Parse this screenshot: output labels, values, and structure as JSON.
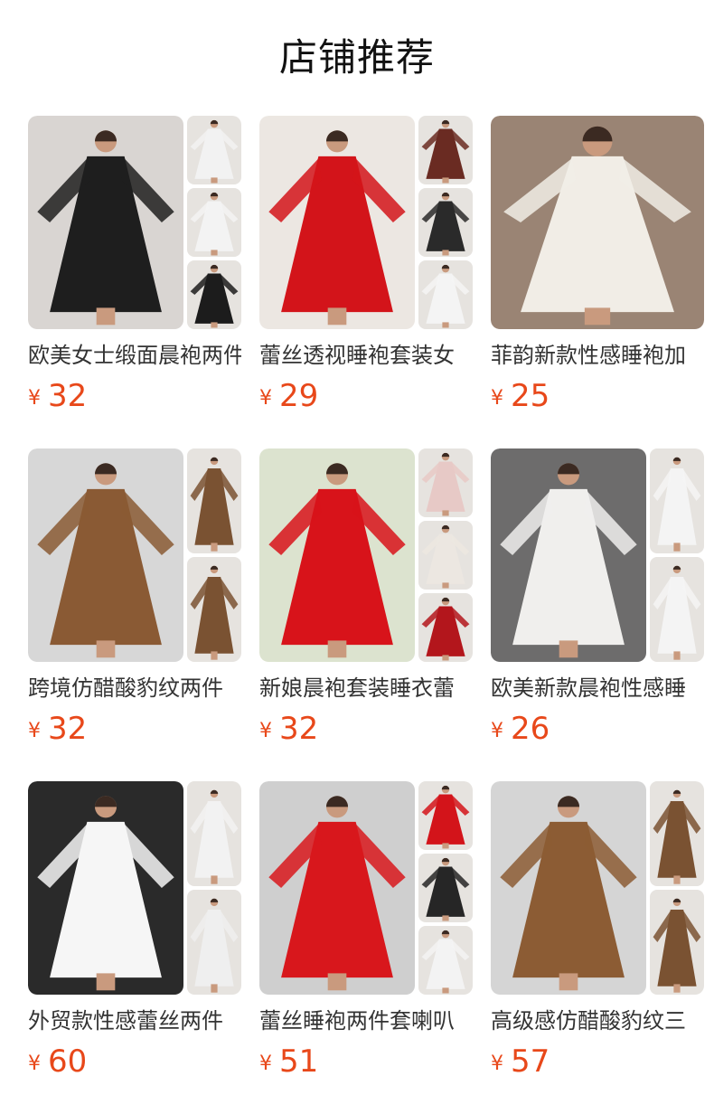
{
  "header": {
    "title": "店铺推荐"
  },
  "currency_symbol": "¥",
  "products": [
    {
      "name": "欧美女士缎面晨袍两件",
      "price": "32",
      "main_color": "#1e1e1e",
      "bg_color": "#d9d5d2",
      "thumbs": [
        "#f2f2f2",
        "#f3f3f3",
        "#1c1c1c"
      ]
    },
    {
      "name": "蕾丝透视睡袍套装女",
      "price": "29",
      "main_color": "#d3141a",
      "bg_color": "#ece7e2",
      "thumbs": [
        "#6a2b22",
        "#2a2a2a",
        "#f4f4f4"
      ]
    },
    {
      "name": "菲韵新款性感睡袍加",
      "price": "25",
      "main_color": "#f1ede6",
      "bg_color": "#9a8474",
      "thumbs": []
    },
    {
      "name": "跨境仿醋酸豹纹两件",
      "price": "32",
      "main_color": "#8a5a34",
      "bg_color": "#d7d7d7",
      "thumbs": [
        "#7a5232",
        "#7a5232"
      ]
    },
    {
      "name": "新娘晨袍套装睡衣蕾",
      "price": "32",
      "main_color": "#d8131a",
      "bg_color": "#dce3cf",
      "thumbs": [
        "#e7c9c6",
        "#ece7e1",
        "#b3161c"
      ]
    },
    {
      "name": "欧美新款晨袍性感睡",
      "price": "26",
      "main_color": "#f0efed",
      "bg_color": "#6d6c6c",
      "thumbs": [
        "#f4f4f4",
        "#f4f4f4"
      ]
    },
    {
      "name": "外贸款性感蕾丝两件",
      "price": "60",
      "main_color": "#f6f6f6",
      "bg_color": "#2a2a2a",
      "thumbs": [
        "#f2f2f2",
        "#efefef"
      ]
    },
    {
      "name": "蕾丝睡袍两件套喇叭",
      "price": "51",
      "main_color": "#d8171c",
      "bg_color": "#cfcfcf",
      "thumbs": [
        "#d3141a",
        "#262626",
        "#f3f3f3"
      ]
    },
    {
      "name": "高级感仿醋酸豹纹三",
      "price": "57",
      "main_color": "#8c5c34",
      "bg_color": "#d5d5d5",
      "thumbs": [
        "#7a5232",
        "#7a5232"
      ]
    }
  ]
}
